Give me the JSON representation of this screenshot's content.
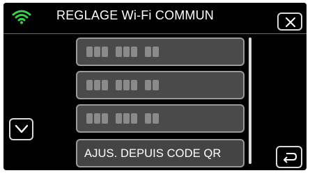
{
  "header": {
    "title": "REGLAGE Wi-Fi COMMUN",
    "wifi_icon": "wifi-icon",
    "close_icon": "close-icon",
    "accent": "#3bd04c"
  },
  "list": {
    "items": [
      {
        "kind": "masked-network",
        "groups": [
          3,
          3,
          2
        ]
      },
      {
        "kind": "masked-network",
        "groups": [
          3,
          3,
          2
        ]
      },
      {
        "kind": "masked-network",
        "groups": [
          3,
          3,
          2
        ]
      }
    ],
    "qr_button_label": "AJUS. DEPUIS CODE QR"
  },
  "controls": {
    "scroll_down_icon": "chevron-down-icon",
    "back_icon": "return-icon"
  }
}
